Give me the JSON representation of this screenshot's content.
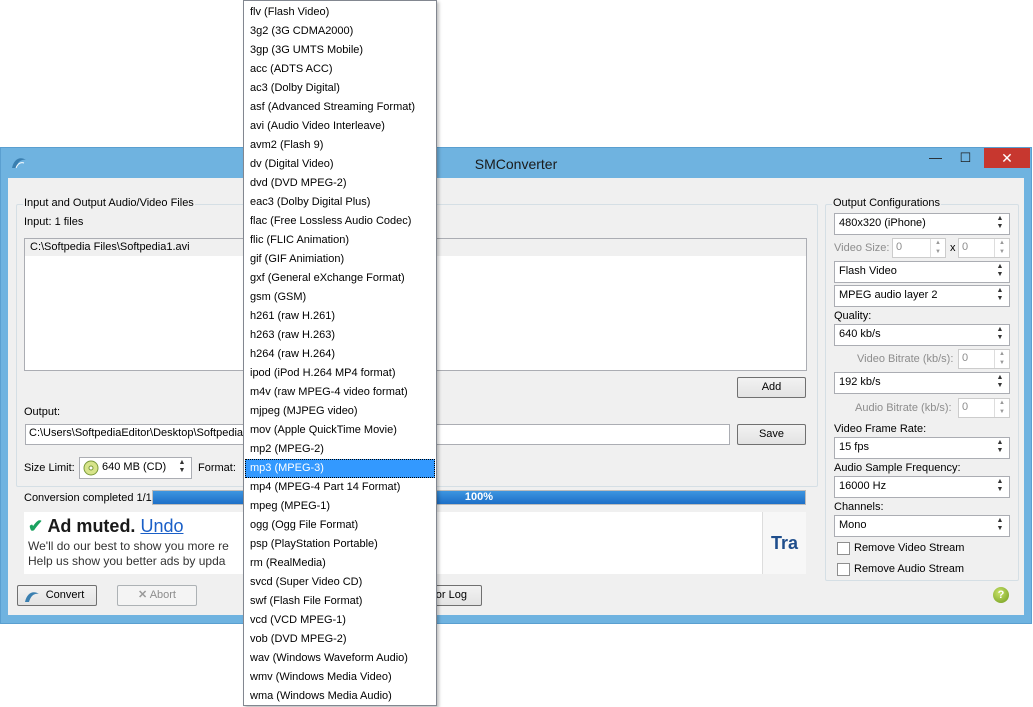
{
  "window": {
    "title": "SMConverter",
    "minimize": "—",
    "maximize": "☐",
    "close": "✕"
  },
  "files_group": {
    "label": "Input and Output Audio/Video Files",
    "input_count": "Input:  1 files",
    "files": [
      "C:\\Softpedia Files\\Softpedia1.avi"
    ],
    "add_label": "Add",
    "output_label": "Output:",
    "output_value": "C:\\Users\\SoftpediaEditor\\Desktop\\Softpedia",
    "save_label": "Save",
    "size_limit_label": "Size Limit:",
    "size_limit_value": "640 MB (CD)",
    "format_label": "Format:",
    "conversion_status": "Conversion completed 1/1",
    "progress_text": "100%",
    "progress_value": 1.0
  },
  "ad": {
    "check": "✔",
    "headline": "Ad muted.",
    "undo": "Undo",
    "line1": "We'll do our best to show you more re",
    "line2": "Help us show you better ads by upda",
    "side_text": "Tra"
  },
  "bottom": {
    "convert_label": "Convert",
    "abort_label": "Abort",
    "log_label": "or Log",
    "help_icon": "?"
  },
  "config": {
    "label": "Output Configurations",
    "preset": "480x320 (iPhone)",
    "video_size_label": "Video Size:",
    "video_w": "0",
    "video_x": "x",
    "video_h": "0",
    "video_codec": "Flash Video",
    "audio_codec": "MPEG audio layer 2",
    "quality_label": "Quality:",
    "quality_value": "640 kb/s",
    "video_bitrate_label": "Video Bitrate (kb/s):",
    "video_bitrate_value": "0",
    "audio_quality_value": "192 kb/s",
    "audio_bitrate_label": "Audio Bitrate (kb/s):",
    "audio_bitrate_value": "0",
    "frame_rate_label": "Video Frame Rate:",
    "frame_rate_value": "15 fps",
    "sample_freq_label": "Audio Sample Frequency:",
    "sample_freq_value": "16000 Hz",
    "channels_label": "Channels:",
    "channels_value": "Mono",
    "remove_video_label": "Remove Video Stream",
    "remove_audio_label": "Remove Audio Stream"
  },
  "format_dropdown": {
    "selected_index": 24,
    "items": [
      "flv (Flash Video)",
      "3g2 (3G CDMA2000)",
      "3gp (3G UMTS Mobile)",
      "acc (ADTS ACC)",
      "ac3 (Dolby Digital)",
      "asf (Advanced Streaming Format)",
      "avi (Audio Video Interleave)",
      "avm2 (Flash 9)",
      "dv (Digital Video)",
      "dvd (DVD MPEG-2)",
      "eac3 (Dolby Digital Plus)",
      "flac (Free Lossless Audio Codec)",
      "flic (FLIC Animation)",
      "gif (GIF Animiation)",
      "gxf (General eXchange Format)",
      "gsm (GSM)",
      "h261 (raw H.261)",
      "h263 (raw H.263)",
      "h264 (raw H.264)",
      "ipod (iPod H.264 MP4 format)",
      "m4v (raw MPEG-4 video format)",
      "mjpeg (MJPEG video)",
      "mov (Apple QuickTime Movie)",
      "mp2 (MPEG-2)",
      "mp3 (MPEG-3)",
      "mp4 (MPEG-4 Part 14 Format)",
      "mpeg (MPEG-1)",
      "ogg (Ogg File Format)",
      "psp (PlayStation Portable)",
      "rm (RealMedia)",
      "svcd (Super Video CD)",
      "swf (Flash File Format)",
      "vcd (VCD MPEG-1)",
      "vob (DVD MPEG-2)",
      "wav (Windows Waveform Audio)",
      "wmv (Windows Media Video)",
      "wma (Windows Media Audio)"
    ]
  }
}
